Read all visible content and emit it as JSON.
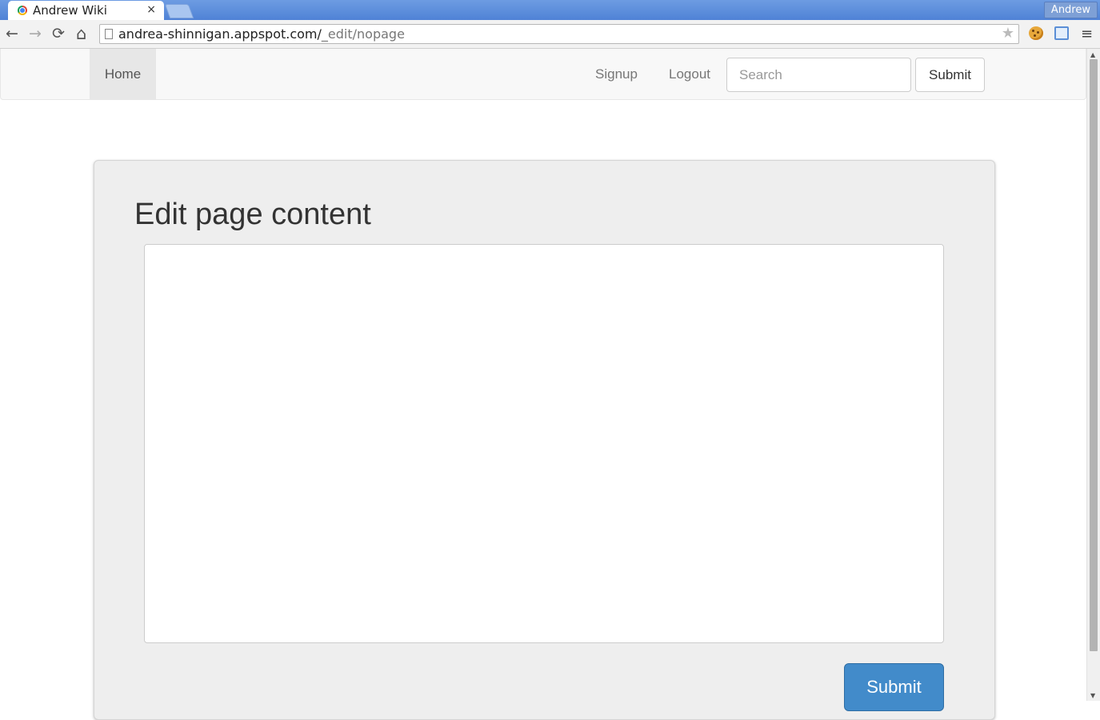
{
  "browser": {
    "tab_title": "Andrew Wiki",
    "tab_close": "×",
    "profile_name": "Andrew",
    "url_host": "andrea-shinnigan.appspot.com/",
    "url_path": "_edit/nopage",
    "nav_glyphs": {
      "back": "←",
      "forward": "→",
      "reload": "⟳",
      "home": "⌂",
      "star": "★",
      "menu": "≡"
    },
    "icons": [
      "back-icon",
      "forward-icon",
      "reload-icon",
      "home-icon",
      "page-icon",
      "bookmark-star-icon",
      "cookie-extension-icon",
      "folder-extension-icon",
      "menu-icon"
    ]
  },
  "navbar": {
    "home_label": "Home",
    "signup_label": "Signup",
    "logout_label": "Logout",
    "search_placeholder": "Search",
    "submit_label": "Submit"
  },
  "editor": {
    "heading": "Edit page content",
    "content_value": "",
    "submit_label": "Submit",
    "submit_color": "#428bca"
  }
}
